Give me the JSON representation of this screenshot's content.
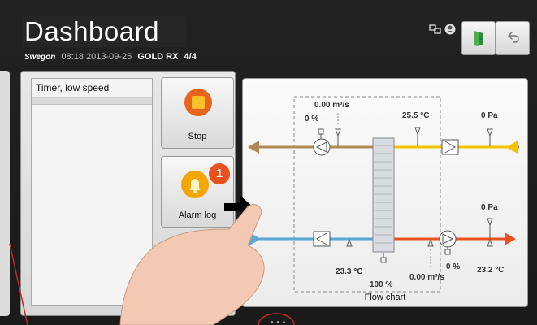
{
  "header": {
    "title": "Dashboard",
    "brand": "Swegon",
    "datetime": "08:18 2013-09-25",
    "model": "GOLD RX",
    "page": "4/4"
  },
  "timer": {
    "items": [
      "Timer, low speed"
    ]
  },
  "buttons": {
    "stop": "Stop",
    "alarm_log": "Alarm log",
    "alarm_count": "1"
  },
  "flow_chart": {
    "label": "Flow chart",
    "exhaust_flow": "0.00 m³/s",
    "exhaust_fan_pct": "0 %",
    "exhaust_temp": "25.5 °C",
    "exhaust_pressure": "0 Pa",
    "supply_pressure": "0 Pa",
    "outdoor_temp": "23.3 °C",
    "heat_exchanger_pct": "100 %",
    "supply_flow": "0.00 m³/s",
    "supply_fan_pct": "0 %",
    "supply_temp": "23.2 °C"
  },
  "colors": {
    "exhaust_air": "#b08a55",
    "extract_air": "#f2c300",
    "outdoor_air": "#5aa6d4",
    "supply_air": "#e8501e",
    "stop_button": "#e8641c",
    "alarm_button": "#f3a500",
    "alarm_badge": "#e8501e"
  }
}
